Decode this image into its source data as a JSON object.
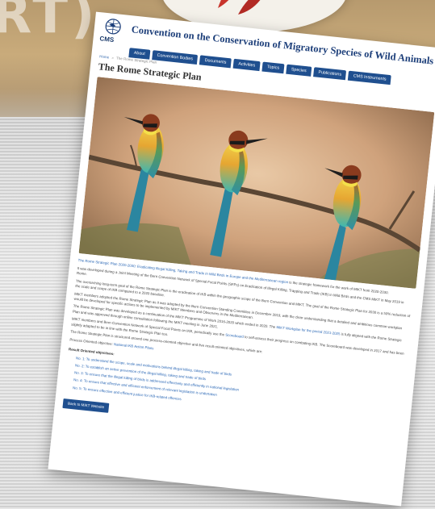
{
  "background": {
    "logo_text": "RT)"
  },
  "header": {
    "logo_label": "CMS",
    "site_title": "Convention on the Conservation of Migratory Species of Wild Animals"
  },
  "nav": {
    "items": [
      {
        "label": "About"
      },
      {
        "label": "Convention Bodies"
      },
      {
        "label": "Documents"
      },
      {
        "label": "Activities"
      },
      {
        "label": "Topics"
      },
      {
        "label": "Species"
      },
      {
        "label": "Publications"
      },
      {
        "label": "CMS Instruments"
      }
    ]
  },
  "breadcrumb": {
    "home": "Home",
    "separator": "»",
    "current": "The Rome Strategic Plan"
  },
  "page": {
    "title": "The Rome Strategic Plan"
  },
  "content": {
    "intro_link": "The Rome Strategic Plan 2020-2030: Eradicating Illegal Killing, Taking and Trade in Wild Birds in Europe and the Mediterranean region",
    "intro_rest": "is the strategic framework for the work of MIKT from 2020-2030.",
    "para2": "It was developed during a Joint Meeting of the Bern Convention Network of Special Focal Points (SFPs) on Eradication of Illegal Killing, Trapping and Trade (IKB) in Wild Birds and the CMS MIKT in May 2019 in Rome.",
    "para3": "The overarching long-term goal of the Rome Strategic Plan is the eradication of IKB within the geographic scope of the Bern Convention and MIKT. The goal of the Rome Strategic Plan for 2030 is a 50% reduction of the scale and scope of IKB compared to a 2020 baseline.",
    "para4": "MIKT members adopted the Rome Strategic Plan as it was adopted by the Bern Convention Standing Committee in December 2019, with the clear understanding that a detailed and ambitious common workplan would be developed for specific actions to be implemented by MIKT Members and Observers in the Mediterranean.",
    "para5_text": "The Rome Strategic Plan was developed as a continuation of the MIKT Programme of Work 2016-2020 which ended in 2020. The",
    "para5_link": "MIKT Workplan for the period 2021-2025",
    "para5_rest": "is fully aligned with the Rome Strategic Plan and was approved through online consultation following the MIKT meeting in June 2021.",
    "para6_text": "MIKT members and Bern Convention Network of Special Focal Points on IKB, periodically use the",
    "para6_link": "Scoreboard",
    "para6_rest": "to self-assess their progress on combating IKB. The Scoreboard was developed in 2017 and has been slightly adapted to be in line with the Rome Strategic Plan too.",
    "para7": "The Rome Strategic Plan is structured around one process-oriented objective and five result-oriented objectives, which are:",
    "process_label": "Process Oriented objective:",
    "process_link": "National IKB Action Plans",
    "result_label": "Result Oriented objectives:",
    "objectives": [
      "No. 1: To understand the scope, scale and motivations behind illegal killing, taking and trade of birds",
      "No. 2: To establish an active prevention of the illegal killing, taking and trade of birds",
      "No. 3: To ensure that the illegal killing of birds is addressed effectively and efficiently in national legislation",
      "No. 4: To ensure that effective and efficient enforcement of relevant legislation is undertaken",
      "No. 5: To ensure effective and efficient justice for IKB-related offences"
    ],
    "back_button": "Back to MIKT Website"
  },
  "colors": {
    "nav_bg": "#1f4f8f",
    "title": "#1d3f7a",
    "link": "#2a67b5"
  }
}
